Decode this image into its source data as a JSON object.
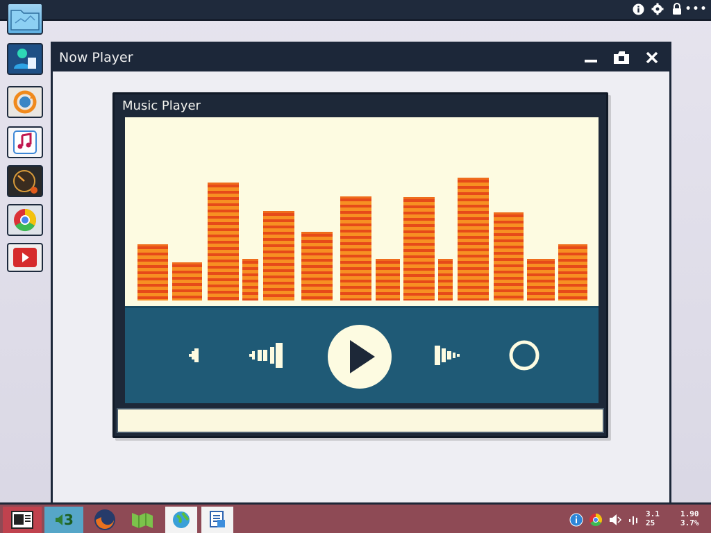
{
  "window": {
    "title": "Now Player"
  },
  "player": {
    "title": "Music Player"
  },
  "taskbar": {
    "workspace_label": "3",
    "clock": {
      "line1_a": "3.1",
      "line1_b": "1.90",
      "line2_a": "25",
      "line2_b": "3.7%"
    }
  },
  "visualizer": {
    "levels": [
      0.46,
      0.31,
      0.96,
      0.34,
      0.73,
      0.56,
      0.85,
      0.34,
      0.84,
      0.34,
      1.0,
      0.72,
      0.34,
      0.46
    ]
  },
  "colors": {
    "accent": "#e64a19",
    "bar_alt": "#f79022",
    "controls_bg": "#1f5a76",
    "title_bar": "#1c2739",
    "taskbar": "#8e4a55"
  }
}
